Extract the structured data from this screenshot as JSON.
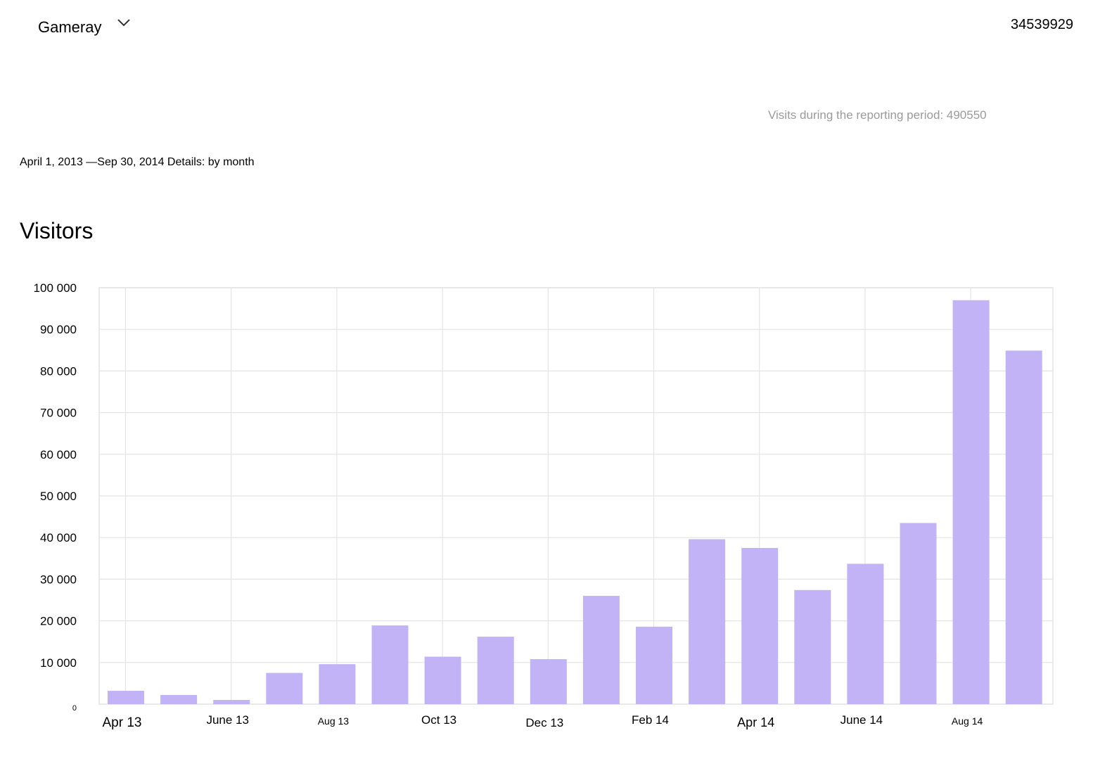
{
  "header": {
    "site_name": "Gameray",
    "site_dropdown_icon": "chevron-down-icon",
    "counter_id": "34539929"
  },
  "summary": {
    "visits_total_text": "Visits during the reporting period: 490550"
  },
  "period_text": "April 1, 2013 —Sep 30, 2014 Details: by month",
  "chart_heading": "Visitors",
  "chart_data": {
    "type": "bar",
    "title": "Visitors",
    "xlabel": "",
    "ylabel": "",
    "ylim": [
      0,
      100000
    ],
    "grid": true,
    "bar_color": "#c2b3f6",
    "grid_color": "#e4e4e4",
    "y_ticks": [
      {
        "value": 0,
        "label": "0"
      },
      {
        "value": 10000,
        "label": "10 000"
      },
      {
        "value": 20000,
        "label": "20 000"
      },
      {
        "value": 30000,
        "label": "30 000"
      },
      {
        "value": 40000,
        "label": "40 000"
      },
      {
        "value": 50000,
        "label": "50 000"
      },
      {
        "value": 60000,
        "label": "60 000"
      },
      {
        "value": 70000,
        "label": "70 000"
      },
      {
        "value": 80000,
        "label": "80 000"
      },
      {
        "value": 90000,
        "label": "90 000"
      },
      {
        "value": 100000,
        "label": "100 000"
      }
    ],
    "x_tick_labels": [
      "Apr 13",
      "June 13",
      "Aug 13",
      "Oct 13",
      "Dec 13",
      "Feb 14",
      "Apr 14",
      "June 14",
      "Aug 14"
    ],
    "categories": [
      "Apr 13",
      "May 13",
      "June 13",
      "Jul 13",
      "Aug 13",
      "Sep 13",
      "Oct 13",
      "Nov 13",
      "Dec 13",
      "Jan 14",
      "Feb 14",
      "Mar 14",
      "Apr 14",
      "May 14",
      "June 14",
      "Jul 14",
      "Aug 14",
      "Sep 14"
    ],
    "values": [
      3200,
      2200,
      1000,
      7500,
      9600,
      18900,
      11400,
      16200,
      10800,
      26000,
      18600,
      39600,
      37500,
      27400,
      33700,
      43500,
      97000,
      84900
    ]
  }
}
